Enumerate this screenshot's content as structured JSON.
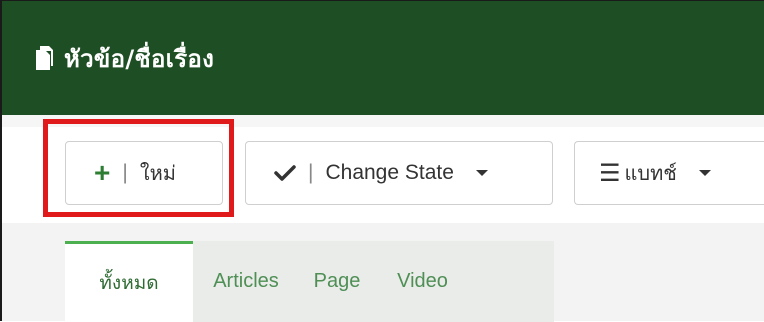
{
  "header": {
    "title": "หัวข้อ/ชื่อเรื่อง",
    "icon": "document-icon"
  },
  "toolbar": {
    "new_label": "ใหม่",
    "new_icon": "plus-icon",
    "change_state_label": "Change State",
    "change_state_icon": "check-icon",
    "batch_label": "แบทช์",
    "batch_icon": "menu-icon",
    "separator": "|"
  },
  "tabs": [
    {
      "label": "ทั้งหมด",
      "active": true
    },
    {
      "label": "Articles",
      "active": false
    },
    {
      "label": "Page",
      "active": false
    },
    {
      "label": "Video",
      "active": false
    }
  ],
  "colors": {
    "header_bg": "#1e4e23",
    "accent_green": "#4caf50",
    "highlight_red": "#e01a1a"
  }
}
